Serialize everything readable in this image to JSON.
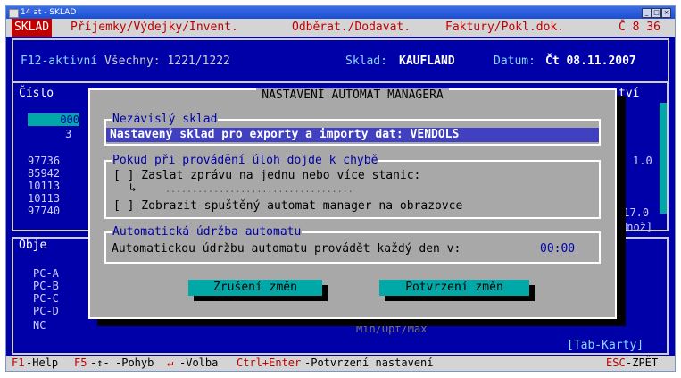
{
  "window": {
    "title": "14 at - SKLAD"
  },
  "menu": {
    "items": [
      {
        "label": "SKLAD"
      },
      {
        "label": "Příjemky/Výdejky/Invent."
      },
      {
        "label": "Odběrat./Dodavat."
      },
      {
        "label": "Faktury/Pokl.dok."
      },
      {
        "label": "Č 8 36"
      }
    ]
  },
  "info": {
    "mode": "F12-aktivní",
    "filter": "Všechny: 1221/1222",
    "warehouse_label": "Sklad:",
    "warehouse": "KAUFLAND",
    "date_label": "Datum:",
    "date": "Čt 08.11.2007"
  },
  "background": {
    "col_left_header": "Číslo",
    "col_right_header": "tví",
    "left_values": [
      "000",
      "3",
      "97736",
      "85942",
      "10113",
      "10113",
      "97740"
    ],
    "right_values": [
      "1.0",
      "117.0"
    ],
    "right_header2": "Množ]",
    "objects_header": "Obje",
    "objects_list": [
      "PC-A",
      "PC-B",
      "PC-C",
      "PC-D",
      "NC"
    ],
    "minoptmax": "Min/Opt/Max",
    "tab_karty": "[Tab-Karty]"
  },
  "dialog": {
    "title": "NASTAVENÍ AUTOMAT MANAGERA",
    "group1": {
      "label": "Nezávislý sklad",
      "text": "Nastavený sklad pro exporty a importy dat: VENDOLS"
    },
    "group2": {
      "label": "Pokud při provádění úloh dojde k chybě",
      "option1": "[ ] Zaslat zprávu na jednu nebo více stanic:",
      "dots": "...................................",
      "option2": "[ ] Zobrazit spuštěný automat manager na obrazovce"
    },
    "group3": {
      "label": "Automatická údržba automatu",
      "text": "Automatickou údržbu automatu provádět každý den v:",
      "time": "00:00"
    },
    "btn_cancel": "Zrušení změn",
    "btn_confirm": "Potvrzení změn"
  },
  "status": {
    "f1": "F1",
    "help": "-Help",
    "f5": "F5",
    "arrows": "-↕-",
    "move": "-Pohyb",
    "enter": "↵",
    "choose": "-Volba",
    "ctrlenter": "Ctrl+Enter",
    "confirm": "-Potvrzení nastavení",
    "esc": "ESC",
    "back": "-ZPĚT"
  },
  "colors": {
    "screen_bg": "#0000a8",
    "dialog_bg": "#a8a8a8",
    "button": "#00a8a8",
    "accent_red": "#c00000"
  }
}
